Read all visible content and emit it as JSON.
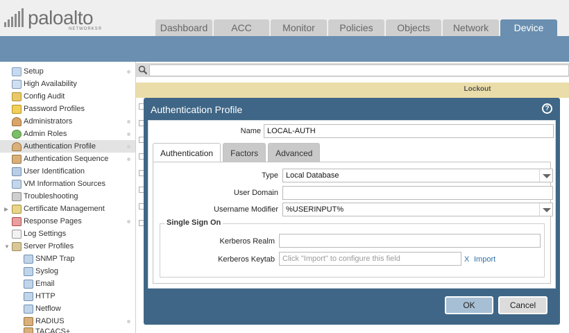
{
  "header": {
    "logo_text": "paloalto",
    "logo_sub": "NETWORKS®",
    "tabs": [
      {
        "label": "Dashboard"
      },
      {
        "label": "ACC"
      },
      {
        "label": "Monitor"
      },
      {
        "label": "Policies"
      },
      {
        "label": "Objects"
      },
      {
        "label": "Network"
      },
      {
        "label": "Device",
        "active": true
      }
    ]
  },
  "sidebar": {
    "items": [
      {
        "label": "Setup"
      },
      {
        "label": "High Availability"
      },
      {
        "label": "Config Audit"
      },
      {
        "label": "Password Profiles"
      },
      {
        "label": "Administrators"
      },
      {
        "label": "Admin Roles"
      },
      {
        "label": "Authentication Profile",
        "selected": true
      },
      {
        "label": "Authentication Sequence"
      },
      {
        "label": "User Identification"
      },
      {
        "label": "VM Information Sources"
      },
      {
        "label": "Troubleshooting"
      },
      {
        "label": "Certificate Management"
      },
      {
        "label": "Response Pages"
      },
      {
        "label": "Log Settings"
      },
      {
        "label": "Server Profiles"
      },
      {
        "label": "SNMP Trap"
      },
      {
        "label": "Syslog"
      },
      {
        "label": "Email"
      },
      {
        "label": "HTTP"
      },
      {
        "label": "Netflow"
      },
      {
        "label": "RADIUS"
      },
      {
        "label": "TACACS+"
      }
    ]
  },
  "grid": {
    "header_lockout": "Lockout"
  },
  "dialog": {
    "title": "Authentication Profile",
    "name_label": "Name",
    "name_value": "LOCAL-AUTH",
    "tabs": [
      {
        "label": "Authentication",
        "active": true
      },
      {
        "label": "Factors"
      },
      {
        "label": "Advanced"
      }
    ],
    "type_label": "Type",
    "type_value": "Local Database",
    "user_domain_label": "User Domain",
    "user_domain_value": "",
    "username_modifier_label": "Username Modifier",
    "username_modifier_value": "%USERINPUT%",
    "sso_title": "Single Sign On",
    "kerberos_realm_label": "Kerberos Realm",
    "kerberos_realm_value": "",
    "kerberos_keytab_label": "Kerberos Keytab",
    "kerberos_keytab_placeholder": "Click \"Import\" to configure this field",
    "import_x": "X",
    "import_label": "Import",
    "ok_label": "OK",
    "cancel_label": "Cancel"
  },
  "colors": {
    "header_blue": "#6a8fb0",
    "dialog_blue": "#3f6686",
    "grid_header": "#ebdda9",
    "link": "#2f6fa6"
  }
}
